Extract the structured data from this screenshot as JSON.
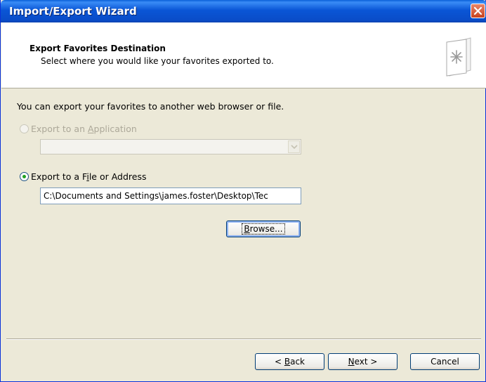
{
  "window": {
    "title": "Import/Export Wizard"
  },
  "header": {
    "title": "Export Favorites Destination",
    "subtitle": "Select where you would like your favorites exported to."
  },
  "body": {
    "intro": "You can export your favorites to another web browser or file.",
    "option_application": {
      "label_pre": "Export to an ",
      "label_accel": "A",
      "label_post": "pplication",
      "enabled": false,
      "selected": false,
      "dropdown_value": ""
    },
    "option_file": {
      "label_pre": "Export to a F",
      "label_accel": "i",
      "label_post": "le or Address",
      "enabled": true,
      "selected": true,
      "path_value": "C:\\Documents and Settings\\james.foster\\Desktop\\Tec"
    },
    "browse": {
      "label_accel": "B",
      "label_post": "rowse..."
    }
  },
  "footer": {
    "back": {
      "label_pre": "< ",
      "label_accel": "B",
      "label_post": "ack"
    },
    "next": {
      "label_accel": "N",
      "label_post": "ext >"
    },
    "cancel": {
      "label": "Cancel"
    }
  },
  "colors": {
    "titlebar": "#0a56d6",
    "dialog_bg": "#ece9d8",
    "radio_selected": "#21a121"
  }
}
